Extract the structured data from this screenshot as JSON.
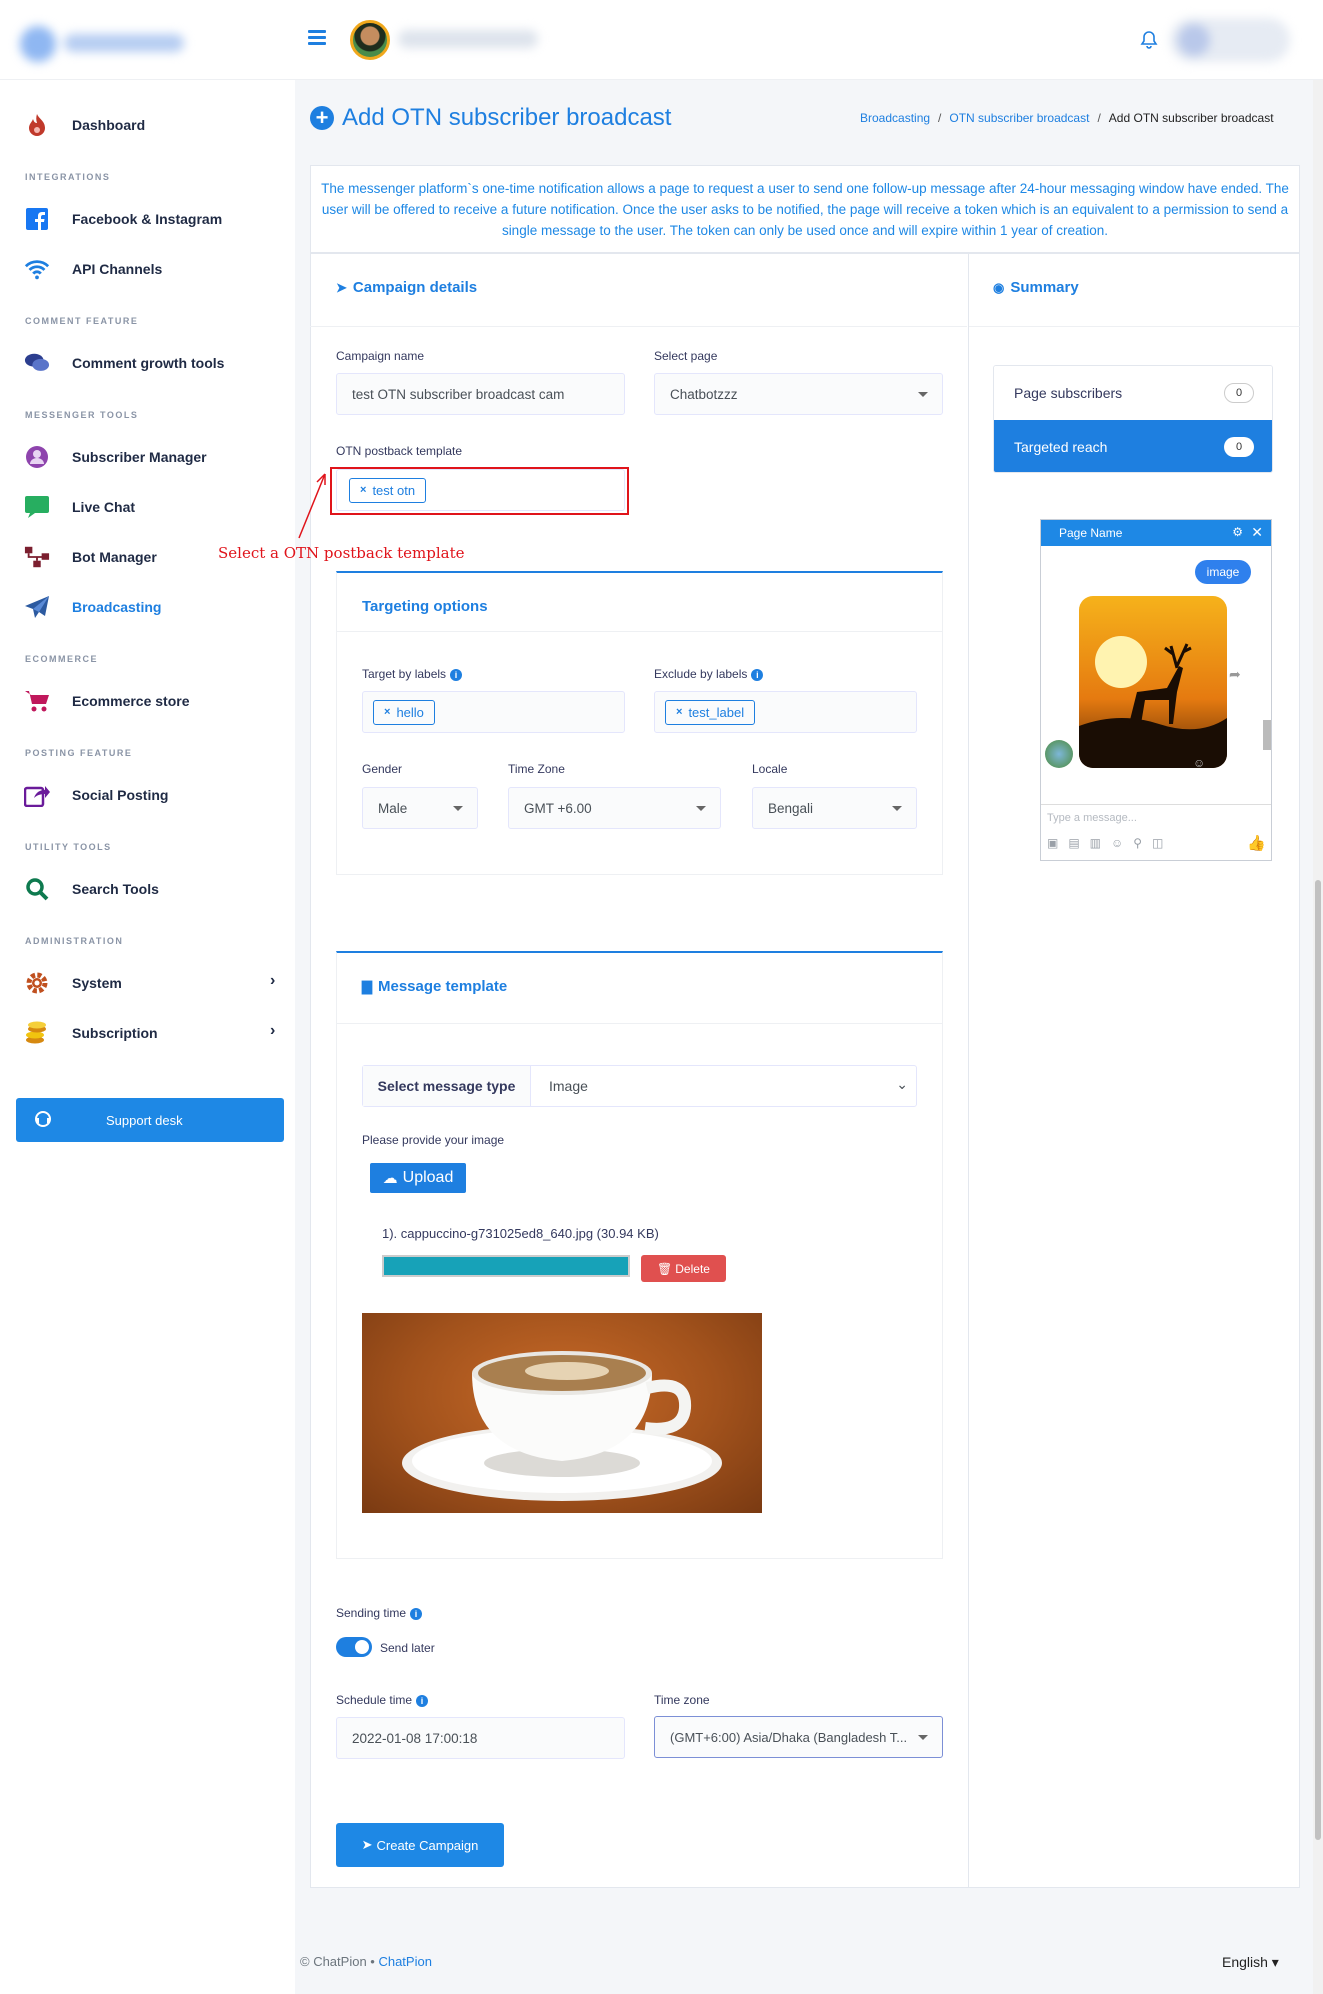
{
  "header": {
    "user_name": "",
    "notification_icon": "bell-icon"
  },
  "sidebar": {
    "items": [
      {
        "label": "Dashboard",
        "icon": "fire-icon"
      },
      {
        "section": "INTEGRATIONS"
      },
      {
        "label": "Facebook & Instagram",
        "icon": "facebook-icon"
      },
      {
        "label": "API Channels",
        "icon": "wifi-icon"
      },
      {
        "section": "COMMENT FEATURE"
      },
      {
        "label": "Comment growth tools",
        "icon": "comments-icon"
      },
      {
        "section": "MESSENGER TOOLS"
      },
      {
        "label": "Subscriber Manager",
        "icon": "user-circle-icon"
      },
      {
        "label": "Live Chat",
        "icon": "chat-icon"
      },
      {
        "label": "Bot Manager",
        "icon": "sitemap-icon"
      },
      {
        "label": "Broadcasting",
        "icon": "paper-plane-icon"
      },
      {
        "section": "ECOMMERCE"
      },
      {
        "label": "Ecommerce store",
        "icon": "cart-icon"
      },
      {
        "section": "POSTING FEATURE"
      },
      {
        "label": "Social Posting",
        "icon": "share-icon"
      },
      {
        "section": "UTILITY TOOLS"
      },
      {
        "label": "Search Tools",
        "icon": "search-icon"
      },
      {
        "section": "ADMINISTRATION"
      },
      {
        "label": "System",
        "icon": "gear-icon"
      },
      {
        "label": "Subscription",
        "icon": "coins-icon"
      }
    ],
    "support": "Support desk"
  },
  "page": {
    "title": "Add OTN subscriber broadcast",
    "breadcrumb": [
      "Broadcasting",
      "OTN subscriber broadcast",
      "Add OTN subscriber broadcast"
    ],
    "info": "The messenger platform`s one-time notification allows a page to request a user to send one follow-up message after 24-hour messaging window have ended. The user will be offered to receive a future notification. Once the user asks to be notified, the page will receive a token which is an equivalent to a permission to send a single message to the user. The token can only be used once and will expire within 1 year of creation."
  },
  "campaign": {
    "title": "Campaign details",
    "name_label": "Campaign name",
    "name_value": "test OTN subscriber broadcast cam",
    "page_label": "Select page",
    "page_value": "Chatbotzzz",
    "otn_label": "OTN postback template",
    "otn_tag": "test otn",
    "annotation": "Select a OTN postback template"
  },
  "targeting": {
    "title": "Targeting options",
    "target_label": "Target by labels",
    "target_tag": "hello",
    "exclude_label": "Exclude by labels",
    "exclude_tag": "test_label",
    "gender_label": "Gender",
    "gender_value": "Male",
    "timezone_label": "Time Zone",
    "timezone_value": "GMT +6.00",
    "locale_label": "Locale",
    "locale_value": "Bengali"
  },
  "message": {
    "title": "Message template",
    "type_label": "Select message type",
    "type_value": "Image",
    "image_prompt": "Please provide your image",
    "upload": "Upload",
    "file": "1). cappuccino-g731025ed8_640.jpg (30.94 KB)",
    "upload_progress": 1.0,
    "delete": "Delete"
  },
  "sending": {
    "time_label": "Sending time",
    "toggle_label": "Send later",
    "toggle_on": true,
    "schedule_label": "Schedule time",
    "schedule_value": "2022-01-08 17:00:18",
    "tz_label": "Time zone",
    "tz_value": "(GMT+6:00) Asia/Dhaka (Bangladesh T...",
    "create": "Create Campaign"
  },
  "summary": {
    "title": "Summary",
    "subscribers_label": "Page subscribers",
    "subscribers_count": "0",
    "reach_label": "Targeted reach",
    "reach_count": "0"
  },
  "preview": {
    "page_name": "Page Name",
    "bubble": "image",
    "input_placeholder": "Type a message..."
  },
  "footer": {
    "copyright": "© ChatPion",
    "brand": "ChatPion",
    "language": "English"
  },
  "colors": {
    "accent": "#1e7fe0",
    "danger": "#e0504f",
    "progress": "#17a2b8"
  }
}
